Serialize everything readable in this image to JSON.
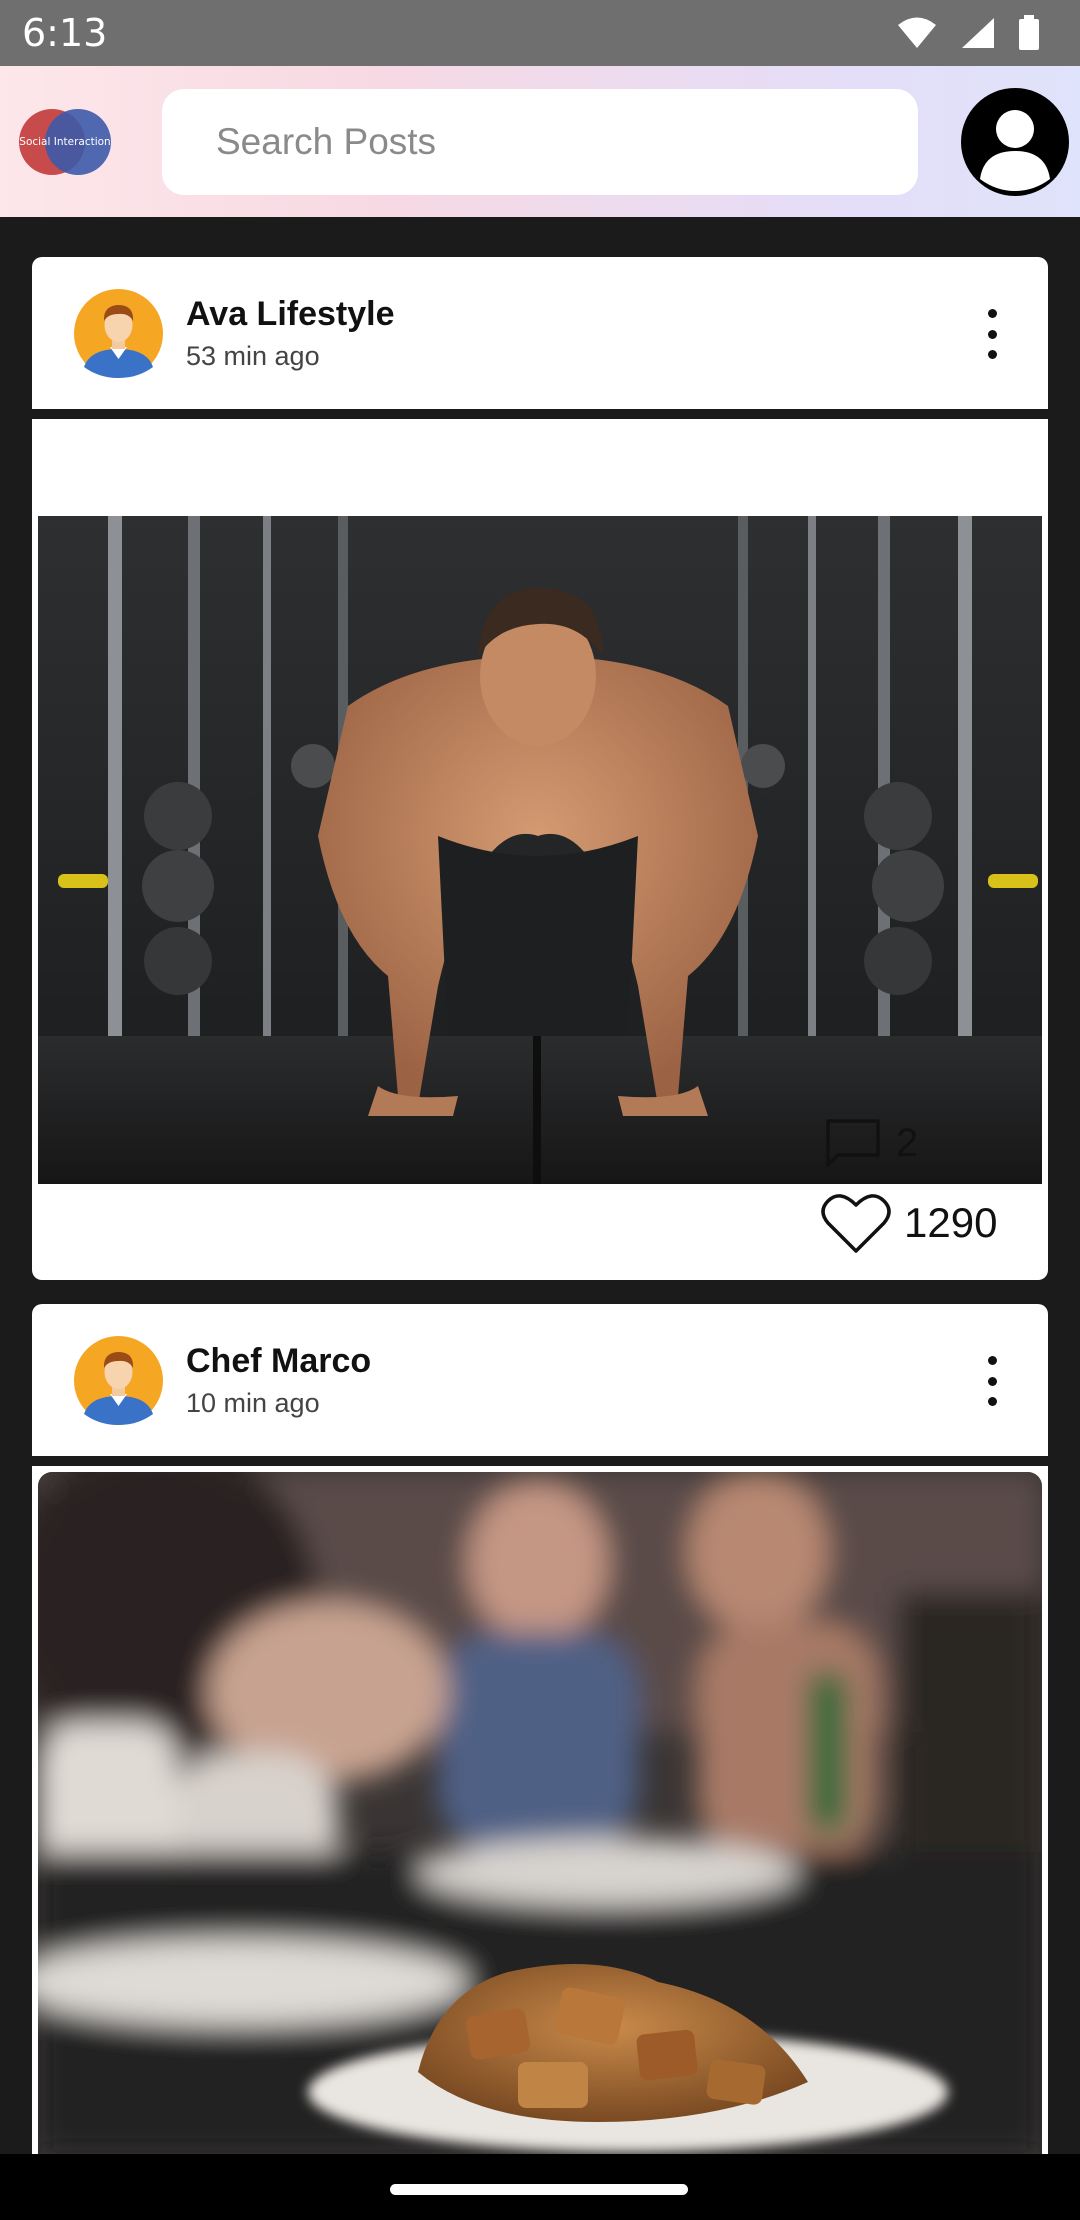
{
  "status_bar": {
    "time": "6:13",
    "icons": [
      "wifi-icon",
      "signal-icon",
      "battery-icon"
    ]
  },
  "header": {
    "logo_text": "Social Interaction",
    "search_placeholder": "Search Posts",
    "search_value": "",
    "gradient_colors": [
      "#fde7ea",
      "#dfe3fb"
    ]
  },
  "posts": [
    {
      "author": "Ava Lifestyle",
      "time": "53 min ago",
      "image": "fitness-pushup-gym-photo",
      "comments": "2",
      "likes": "1290"
    },
    {
      "author": "Chef Marco",
      "time": "10 min ago",
      "image": "restaurant-food-plate-photo"
    }
  ],
  "colors": {
    "background": "#1b1b1b",
    "card": "#ffffff",
    "status_bar": "#6f6f6f",
    "logo_red": "#c84b4b",
    "logo_blue": "#3c5aa8",
    "avatar_orange": "#f5a623"
  }
}
